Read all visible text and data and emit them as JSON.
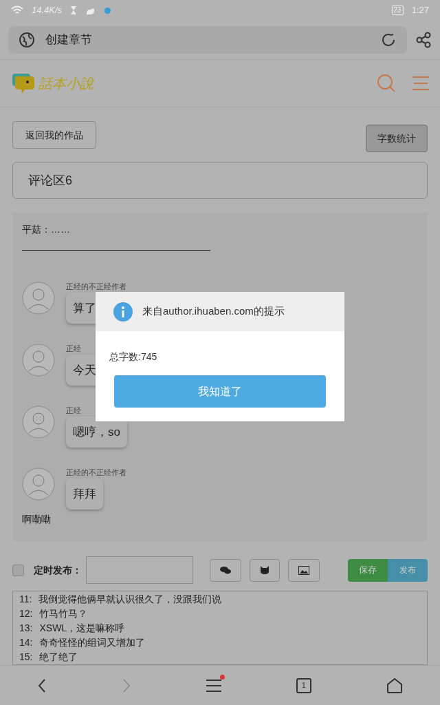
{
  "status_bar": {
    "speed": "14.4K/s",
    "battery": "23",
    "time": "1:27"
  },
  "address_bar": {
    "title": "创建章节"
  },
  "site_header": {
    "logo_text": "話本小說"
  },
  "actions": {
    "back_button": "返回我的作品",
    "stats_button": {
      "label": "字数统计",
      "pressed": true
    }
  },
  "title_field": {
    "value": "评论区6"
  },
  "content": {
    "intro": "平菇：……",
    "divider_line": "—————————————————————",
    "messages": [
      {
        "author": "正经的不正经作者",
        "text": "算了"
      },
      {
        "author": "正经",
        "text": "今天"
      },
      {
        "author": "正经",
        "text": "嗯哼，so"
      },
      {
        "author": "正经的不正经作者",
        "text": "拜拜"
      }
    ],
    "trailing_text": "啊嘞嘞"
  },
  "dialog": {
    "title": "来自author.ihuaben.com的提示",
    "message": "总字数:745",
    "button": "我知道了"
  },
  "publish_bar": {
    "schedule_label": "定时发布：",
    "schedule_checked": false,
    "save": "保存",
    "publish": "发布"
  },
  "editor_lines": [
    {
      "number": "11:",
      "text": "我倒觉得他俩早就认识很久了，没跟我们说"
    },
    {
      "number": "12:",
      "text": "竹马竹马？"
    },
    {
      "number": "13:",
      "text": "XSWL，这是嘛称呼"
    },
    {
      "number": "14:",
      "text": "奇奇怪怪的组词又增加了"
    },
    {
      "number": "15:",
      "text": "绝了绝了"
    }
  ],
  "bottom_nav": {
    "tab_count": "1",
    "menu_badge": true
  }
}
